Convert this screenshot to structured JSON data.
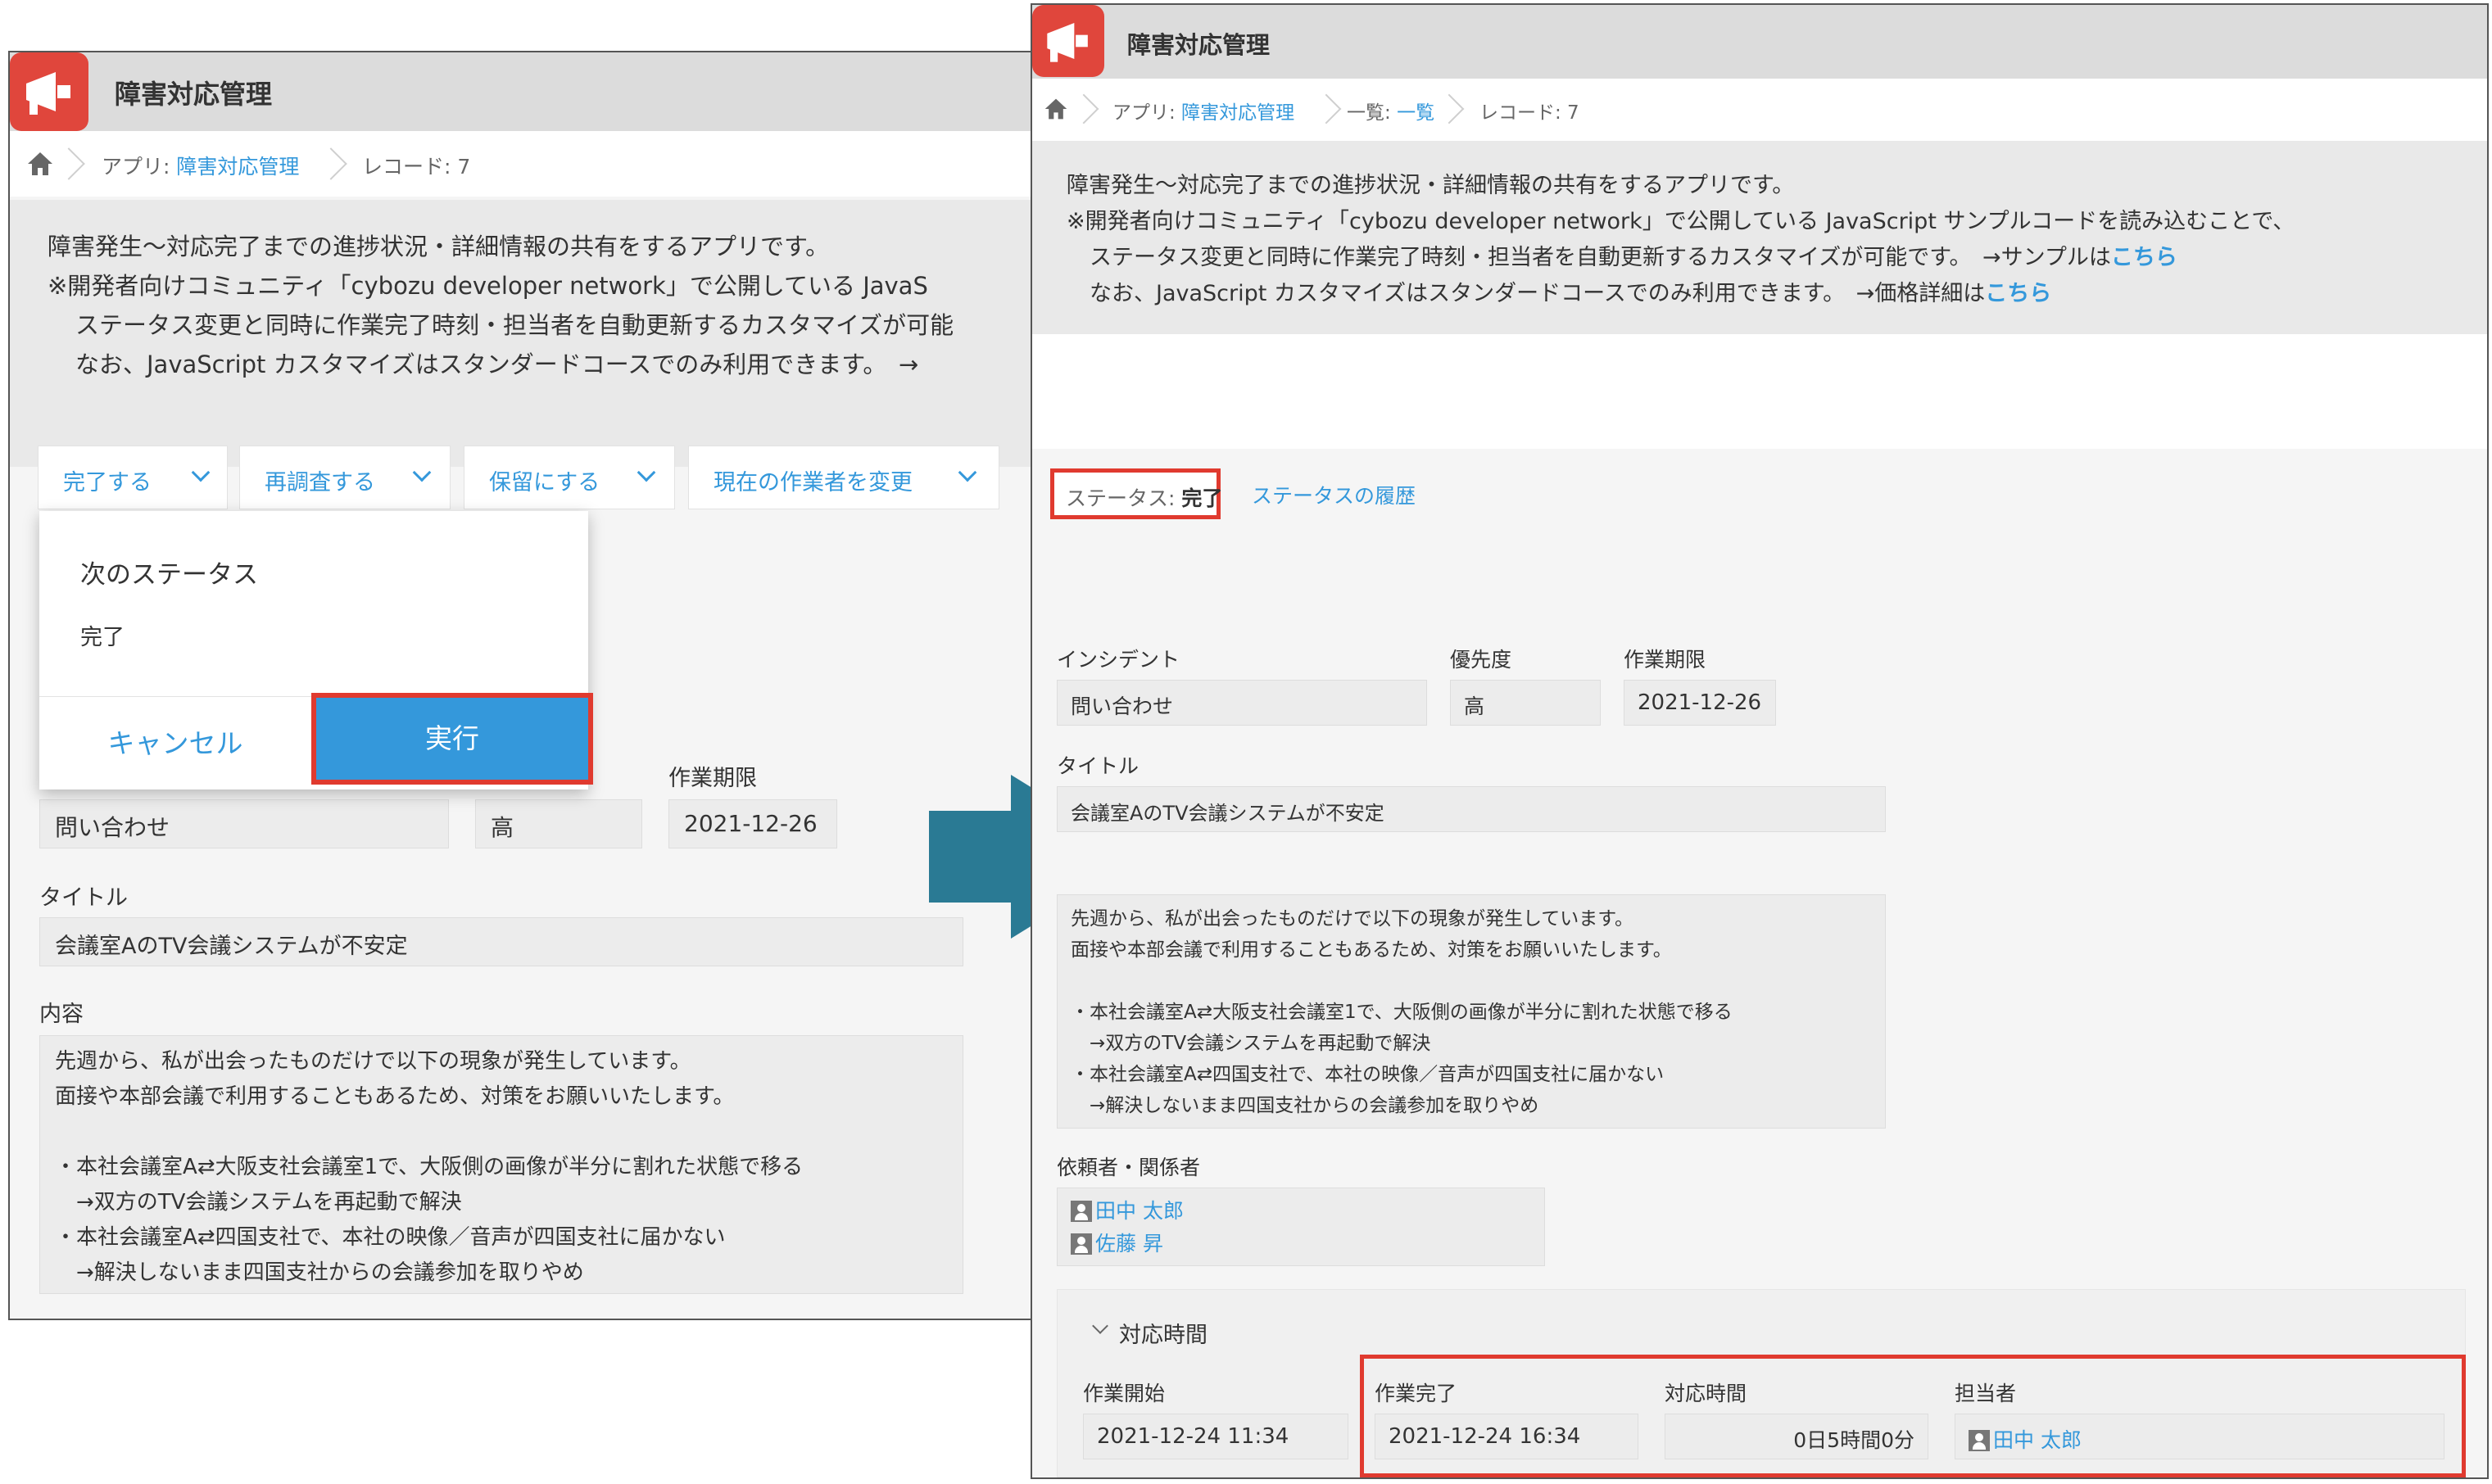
{
  "app": {
    "title": "障害対応管理",
    "description": [
      "障害発生〜対応完了までの進捗状況・詳細情報の共有をするアプリです。",
      "※開発者向けコミュニティ「cybozu developer network」で公開している JavaScript サンプルコードを読み込むことで、",
      "ステータス変更と同時に作業完了時刻・担当者を自動更新するカスタマイズが可能です。",
      "なお、JavaScript カスタマイズはスタンダードコースでのみ利用できます。"
    ],
    "sample_prefix": "→サンプルは",
    "price_prefix": "→価格詳細は",
    "link_here": "こちら"
  },
  "left": {
    "desc_visible": [
      "障害発生〜対応完了までの進捗状況・詳細情報の共有をするアプリです。",
      "※開発者向けコミュニティ「cybozu developer network」で公開している JavaS",
      "ステータス変更と同時に作業完了時刻・担当者を自動更新するカスタマイズが可能",
      "なお、JavaScript カスタマイズはスタンダードコースでのみ利用できます。　→"
    ]
  },
  "breadcrumb": {
    "app_prefix": "アプリ: ",
    "app_name": "障害対応管理",
    "list_prefix": "一覧: ",
    "list_name": "一覧",
    "record": "レコード: 7"
  },
  "actions": {
    "complete": "完了する",
    "reinvestigate": "再調査する",
    "hold": "保留にする",
    "change_assignee": "現在の作業者を変更"
  },
  "popup": {
    "next_status_label": "次のステータス",
    "next_status_value": "完了",
    "cancel": "キャンセル",
    "run": "実行"
  },
  "status": {
    "label": "ステータス: ",
    "value": "完了",
    "history": "ステータスの履歴"
  },
  "fields": {
    "incident_label": "インシデント",
    "incident_value": "問い合わせ",
    "priority_label": "優先度",
    "priority_value": "高",
    "due_label": "作業期限",
    "due_value": "2021-12-26",
    "title_label": "タイトル",
    "title_value": "会議室AのTV会議システムが不安定",
    "content_label": "内容",
    "content_lines": [
      "先週から、私が出会ったものだけで以下の現象が発生しています。",
      "面接や本部会議で利用することもあるため、対策をお願いいたします。",
      "",
      "・本社会議室A⇄大阪支社会議室1で、大阪側の画像が半分に割れた状態で移る",
      "　→双方のTV会議システムを再起動で解決",
      "・本社会議室A⇄四国支社で、本社の映像／音声が四国支社に届かない",
      "　→解決しないまま四国支社からの会議参加を取りやめ"
    ],
    "requester_label": "依頼者・関係者",
    "requesters": [
      "田中 太郎",
      "佐藤 昇"
    ]
  },
  "response_time": {
    "group_label": "対応時間",
    "start_label": "作業開始",
    "start_value": "2021-12-24 11:34",
    "end_label": "作業完了",
    "end_value": "2021-12-24 16:34",
    "duration_label": "対応時間",
    "duration_value": "0日5時間0分",
    "assignee_label": "担当者",
    "assignee_value": "田中 太郎"
  },
  "colors": {
    "accent": "#3498db",
    "highlight": "#e03a2f",
    "arrow": "#2a7a94",
    "app_icon": "#e0463c"
  },
  "icons": [
    "megaphone-icon",
    "home-icon",
    "chevron-down-icon",
    "user-icon",
    "arrow-right-icon"
  ]
}
